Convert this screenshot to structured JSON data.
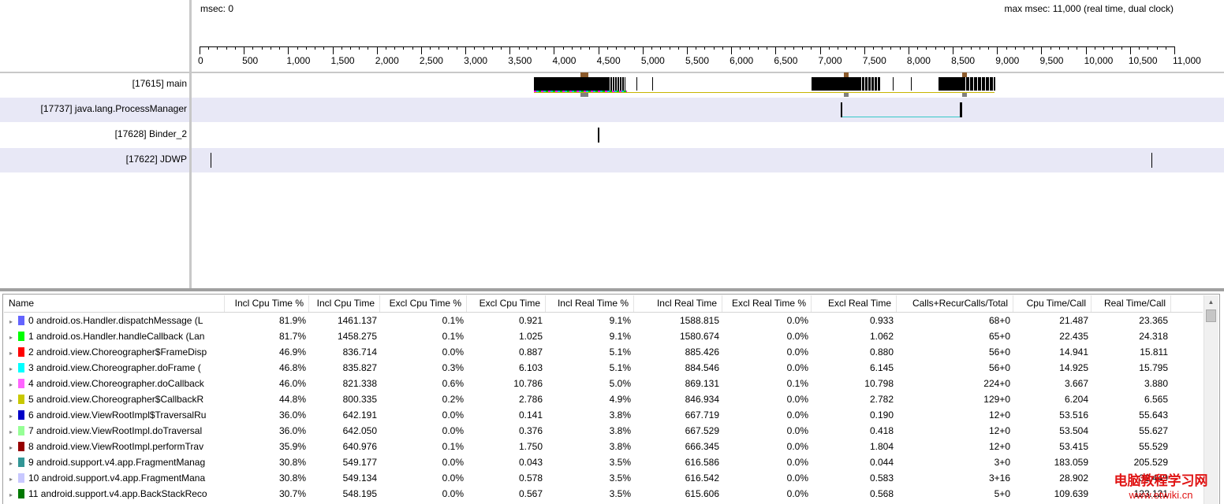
{
  "timeline": {
    "msec_left": "msec: 0",
    "msec_right": "max msec: 11,000 (real time, dual clock)",
    "ticks": [
      "0",
      "500",
      "1,000",
      "1,500",
      "2,000",
      "2,500",
      "3,000",
      "3,500",
      "4,000",
      "4,500",
      "5,000",
      "5,500",
      "6,000",
      "6,500",
      "7,000",
      "7,500",
      "8,000",
      "8,500",
      "9,000",
      "9,500",
      "10,000",
      "10,500",
      "11,000"
    ],
    "threads": [
      {
        "label": "[17615] main"
      },
      {
        "label": "[17737] java.lang.ProcessManager"
      },
      {
        "label": "[17628] Binder_2"
      },
      {
        "label": "[17622] JDWP"
      }
    ]
  },
  "table": {
    "headers": [
      "Name",
      "Incl Cpu Time %",
      "Incl Cpu Time",
      "Excl Cpu Time %",
      "Excl Cpu Time",
      "Incl Real Time %",
      "Incl Real Time",
      "Excl Real Time %",
      "Excl Real Time",
      "Calls+RecurCalls/Total",
      "Cpu Time/Call",
      "Real Time/Call"
    ],
    "rows": [
      {
        "name": "0 android.os.Handler.dispatchMessage (L",
        "color": "#6464ff",
        "c": [
          "81.9%",
          "1461.137",
          "0.1%",
          "0.921",
          "9.1%",
          "1588.815",
          "0.0%",
          "0.933",
          "68+0",
          "21.487",
          "23.365"
        ]
      },
      {
        "name": "1 android.os.Handler.handleCallback (Lan",
        "color": "#00ff00",
        "c": [
          "81.7%",
          "1458.275",
          "0.1%",
          "1.025",
          "9.1%",
          "1580.674",
          "0.0%",
          "1.062",
          "65+0",
          "22.435",
          "24.318"
        ]
      },
      {
        "name": "2 android.view.Choreographer$FrameDisp",
        "color": "#ff0000",
        "c": [
          "46.9%",
          "836.714",
          "0.0%",
          "0.887",
          "5.1%",
          "885.426",
          "0.0%",
          "0.880",
          "56+0",
          "14.941",
          "15.811"
        ]
      },
      {
        "name": "3 android.view.Choreographer.doFrame (",
        "color": "#00ffff",
        "c": [
          "46.8%",
          "835.827",
          "0.3%",
          "6.103",
          "5.1%",
          "884.546",
          "0.0%",
          "6.145",
          "56+0",
          "14.925",
          "15.795"
        ]
      },
      {
        "name": "4 android.view.Choreographer.doCallback",
        "color": "#ff64ff",
        "c": [
          "46.0%",
          "821.338",
          "0.6%",
          "10.786",
          "5.0%",
          "869.131",
          "0.1%",
          "10.798",
          "224+0",
          "3.667",
          "3.880"
        ]
      },
      {
        "name": "5 android.view.Choreographer$CallbackR",
        "color": "#c8c800",
        "c": [
          "44.8%",
          "800.335",
          "0.2%",
          "2.786",
          "4.9%",
          "846.934",
          "0.0%",
          "2.782",
          "129+0",
          "6.204",
          "6.565"
        ]
      },
      {
        "name": "6 android.view.ViewRootImpl$TraversalRu",
        "color": "#0000c8",
        "c": [
          "36.0%",
          "642.191",
          "0.0%",
          "0.141",
          "3.8%",
          "667.719",
          "0.0%",
          "0.190",
          "12+0",
          "53.516",
          "55.643"
        ]
      },
      {
        "name": "7 android.view.ViewRootImpl.doTraversal",
        "color": "#96ff96",
        "c": [
          "36.0%",
          "642.050",
          "0.0%",
          "0.376",
          "3.8%",
          "667.529",
          "0.0%",
          "0.418",
          "12+0",
          "53.504",
          "55.627"
        ]
      },
      {
        "name": "8 android.view.ViewRootImpl.performTrav",
        "color": "#960000",
        "c": [
          "35.9%",
          "640.976",
          "0.1%",
          "1.750",
          "3.8%",
          "666.345",
          "0.0%",
          "1.804",
          "12+0",
          "53.415",
          "55.529"
        ]
      },
      {
        "name": "9 android.support.v4.app.FragmentManag",
        "color": "#329696",
        "c": [
          "30.8%",
          "549.177",
          "0.0%",
          "0.043",
          "3.5%",
          "616.586",
          "0.0%",
          "0.044",
          "3+0",
          "183.059",
          "205.529"
        ]
      },
      {
        "name": "10 android.support.v4.app.FragmentMana",
        "color": "#c8c8ff",
        "c": [
          "30.8%",
          "549.134",
          "0.0%",
          "0.578",
          "3.5%",
          "616.542",
          "0.0%",
          "0.583",
          "3+16",
          "28.902",
          "32.449"
        ]
      },
      {
        "name": "11 android.support.v4.app.BackStackReco",
        "color": "#007800",
        "c": [
          "30.7%",
          "548.195",
          "0.0%",
          "0.567",
          "3.5%",
          "615.606",
          "0.0%",
          "0.568",
          "5+0",
          "109.639",
          "123.121"
        ]
      }
    ]
  },
  "watermark": {
    "line1": "电脑教程学习网",
    "line2": "www.etwiki.cn"
  }
}
